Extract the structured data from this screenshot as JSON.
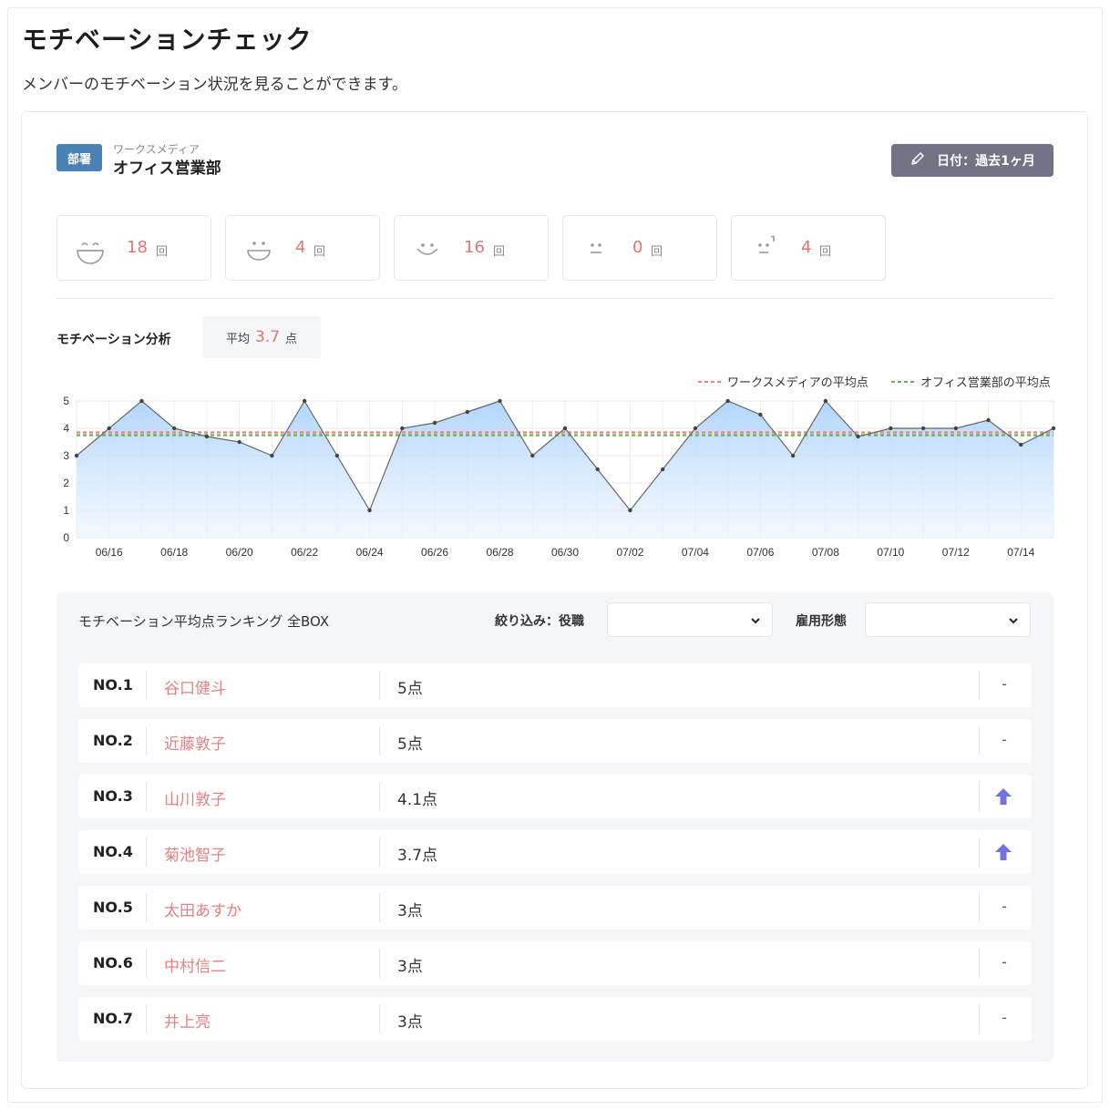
{
  "page": {
    "title": "モチベーションチェック",
    "description": "メンバーのモチベーション状況を見ることができます。"
  },
  "department": {
    "badge": "部署",
    "company": "ワークスメディア",
    "name": "オフィス営業部"
  },
  "date_button": {
    "label": "日付：過去1ヶ月",
    "icon": "pencil-icon"
  },
  "stats": [
    {
      "icon": "big-smile-face-icon",
      "count": "18",
      "unit": "回"
    },
    {
      "icon": "smile-face-icon",
      "count": "4",
      "unit": "回"
    },
    {
      "icon": "happy-face-icon",
      "count": "16",
      "unit": "回"
    },
    {
      "icon": "neutral-face-icon",
      "count": "0",
      "unit": "回"
    },
    {
      "icon": "sweat-face-icon",
      "count": "4",
      "unit": "回"
    }
  ],
  "analysis": {
    "title": "モチベーション分析",
    "avg_label": "平均",
    "avg_value": "3.7",
    "avg_unit": "点"
  },
  "colors": {
    "accent_red": "#e57373",
    "company_line": "#f08080",
    "dept_line": "#6ab04c",
    "series_line": "#666666",
    "area_fill": "#bcdcfb",
    "badge": "#4a82b8",
    "button": "#727385",
    "arrow": "#6f73e0"
  },
  "chart_data": {
    "type": "area",
    "x": [
      "06/15",
      "06/16",
      "06/17",
      "06/18",
      "06/19",
      "06/20",
      "06/21",
      "06/22",
      "06/23",
      "06/24",
      "06/25",
      "06/26",
      "06/27",
      "06/28",
      "06/29",
      "06/30",
      "07/01",
      "07/02",
      "07/03",
      "07/04",
      "07/05",
      "07/06",
      "07/07",
      "07/08",
      "07/09",
      "07/10",
      "07/11",
      "07/12",
      "07/13",
      "07/14",
      "07/15"
    ],
    "x_tick_labels": [
      "06/16",
      "06/18",
      "06/20",
      "06/22",
      "06/24",
      "06/26",
      "06/28",
      "06/30",
      "07/02",
      "07/04",
      "07/06",
      "07/08",
      "07/10",
      "07/12",
      "07/14"
    ],
    "series": [
      {
        "values": [
          3,
          4,
          5,
          4,
          3.7,
          3.5,
          3,
          5,
          3,
          1,
          4,
          4.2,
          4.6,
          5,
          3,
          4,
          2.5,
          1,
          2.5,
          4,
          5,
          4.5,
          3,
          5,
          3.7,
          4,
          4,
          4,
          4.3,
          3.4,
          4
        ]
      }
    ],
    "reference_lines": [
      {
        "name": "ワークスメディアの平均点",
        "value": 3.85,
        "style": "dashed",
        "color": "#f08080"
      },
      {
        "name": "オフィス営業部の平均点",
        "value": 3.75,
        "style": "dashed",
        "color": "#6ab04c"
      }
    ],
    "ylim": [
      0,
      5
    ],
    "y_ticks": [
      0,
      1,
      2,
      3,
      4,
      5
    ],
    "grid": true,
    "legend": "top-right"
  },
  "ranking": {
    "title": "モチベーション平均点ランキング 全BOX",
    "filter_role_label": "絞り込み：役職",
    "filter_employment_label": "雇用形態",
    "role_value": "",
    "employment_value": "",
    "rows": [
      {
        "no": "NO.1",
        "name": "谷口健斗",
        "score": "5点",
        "trend": "-"
      },
      {
        "no": "NO.2",
        "name": "近藤敦子",
        "score": "5点",
        "trend": "-"
      },
      {
        "no": "NO.3",
        "name": "山川敦子",
        "score": "4.1点",
        "trend": "up"
      },
      {
        "no": "NO.4",
        "name": "菊池智子",
        "score": "3.7点",
        "trend": "up"
      },
      {
        "no": "NO.5",
        "name": "太田あすか",
        "score": "3点",
        "trend": "-"
      },
      {
        "no": "NO.6",
        "name": "中村信二",
        "score": "3点",
        "trend": "-"
      },
      {
        "no": "NO.7",
        "name": "井上亮",
        "score": "3点",
        "trend": "-"
      }
    ]
  }
}
